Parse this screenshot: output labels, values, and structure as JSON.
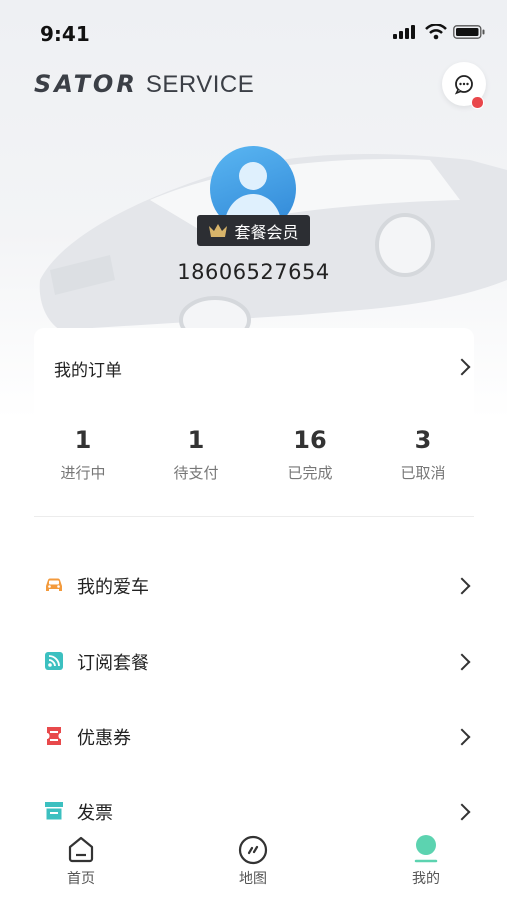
{
  "status_bar": {
    "time": "9:41"
  },
  "brand": {
    "logo_part1": "SATOR",
    "logo_part2": "SERVICE"
  },
  "profile": {
    "badge": "套餐会员",
    "phone": "18606527654"
  },
  "orders": {
    "title": "我的订单",
    "stats": [
      {
        "count": "1",
        "label": "进行中"
      },
      {
        "count": "1",
        "label": "待支付"
      },
      {
        "count": "16",
        "label": "已完成"
      },
      {
        "count": "3",
        "label": "已取消"
      }
    ]
  },
  "menu": [
    {
      "label": "我的爱车",
      "icon": "car-icon",
      "color": "#f39a3c"
    },
    {
      "label": "订阅套餐",
      "icon": "rss-icon",
      "color": "#3cc0c0"
    },
    {
      "label": "优惠券",
      "icon": "coupon-icon",
      "color": "#e8494b"
    },
    {
      "label": "发票",
      "icon": "invoice-icon",
      "color": "#3cc0c0"
    }
  ],
  "tabs": [
    {
      "label": "首页",
      "icon": "home-icon"
    },
    {
      "label": "地图",
      "icon": "compass-icon"
    },
    {
      "label": "我的",
      "icon": "profile-icon",
      "active_color": "#5cd3b0"
    }
  ],
  "notification_dot_color": "#e9474b"
}
